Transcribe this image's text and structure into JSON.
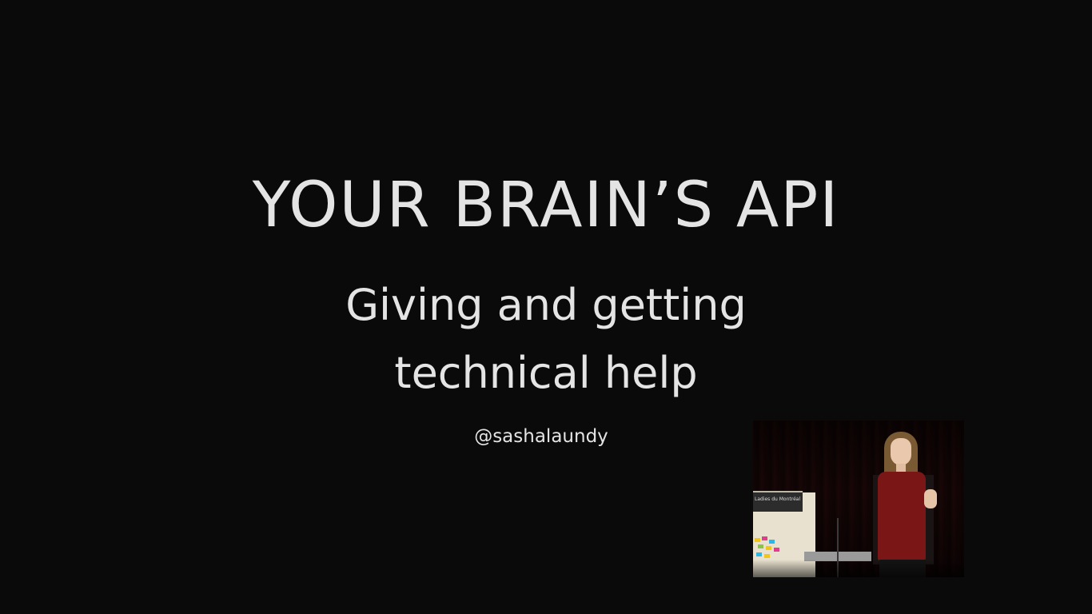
{
  "slide": {
    "title": "YOUR BRAIN’S API",
    "subtitle_line1": "Giving and getting",
    "subtitle_line2": "technical help",
    "handle": "@sashalaundy"
  },
  "inset": {
    "podium_label": "Ladies du Montréal"
  },
  "colors": {
    "background": "#0a0a0a",
    "text": "#e4e4e4",
    "speaker_top": "#7b1616"
  }
}
